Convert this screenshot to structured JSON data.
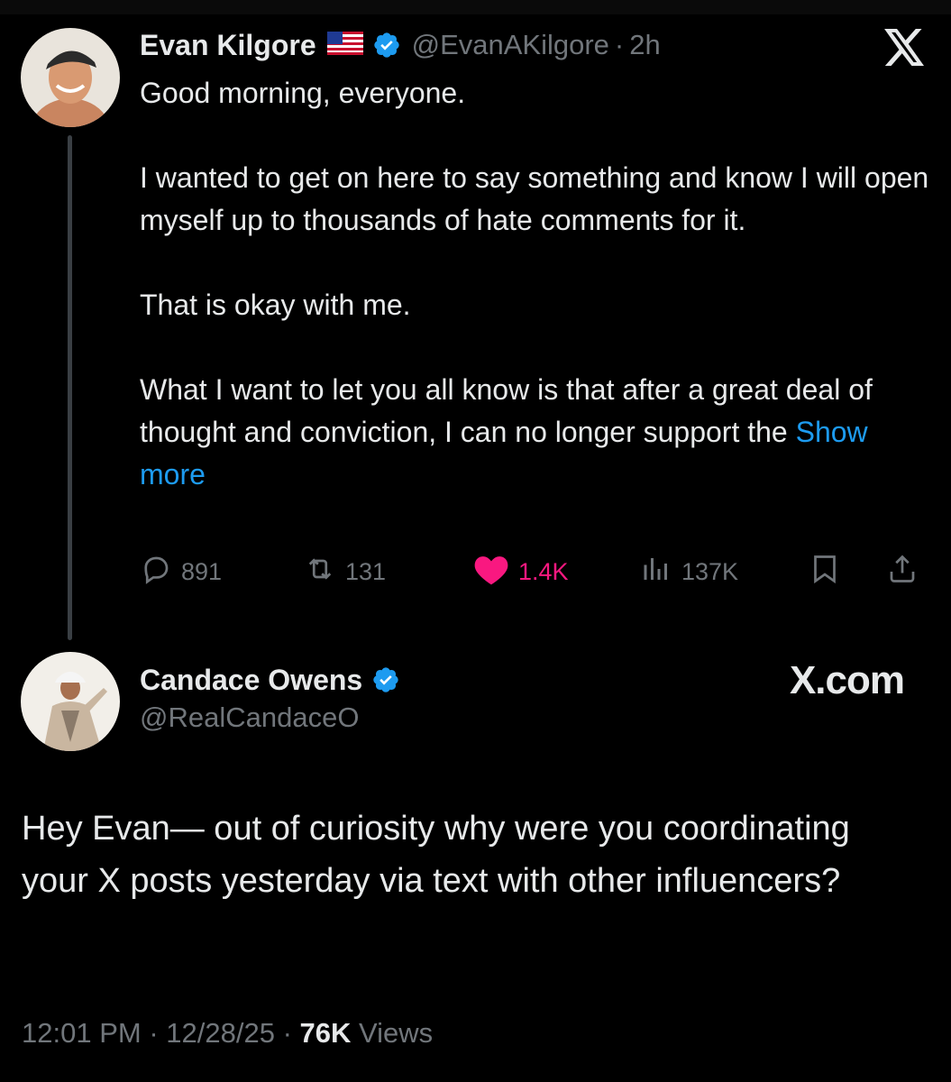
{
  "original_tweet": {
    "display_name": "Evan Kilgore",
    "flag_emoji": "🇺🇸",
    "handle": "@EvanAKilgore",
    "separator": "·",
    "time": "2h",
    "paragraphs": [
      "Good morning, everyone.",
      "I wanted to get on here to say something and know I will open myself up to thousands of hate comments for it.",
      "That is okay with me.",
      "What I want to let you all know is that after a great deal of thought and conviction, I can no longer support the"
    ],
    "show_more": "Show more",
    "stats": {
      "replies": "891",
      "reposts": "131",
      "likes": "1.4K",
      "views": "137K"
    }
  },
  "reply_tweet": {
    "display_name": "Candace Owens",
    "handle": "@RealCandaceO",
    "watermark": "X.com",
    "text": "Hey Evan— out of curiosity why were you coordinating your X posts yesterday via text with other influencers?",
    "timestamp": "12:01 PM",
    "date": "12/28/25",
    "separator": "·",
    "views_count": "76K",
    "views_label": "Views"
  },
  "icons": {
    "brand": "x-logo-icon",
    "verified": "verified-badge-icon",
    "reply": "reply-icon",
    "repost": "repost-icon",
    "like": "heart-icon",
    "views": "views-chart-icon",
    "bookmark": "bookmark-icon",
    "share": "share-icon"
  },
  "colors": {
    "background": "#000000",
    "text": "#e7e9ea",
    "muted": "#71767b",
    "link": "#1d9bf0",
    "like": "#f91880",
    "verified": "#1d9bf0"
  }
}
